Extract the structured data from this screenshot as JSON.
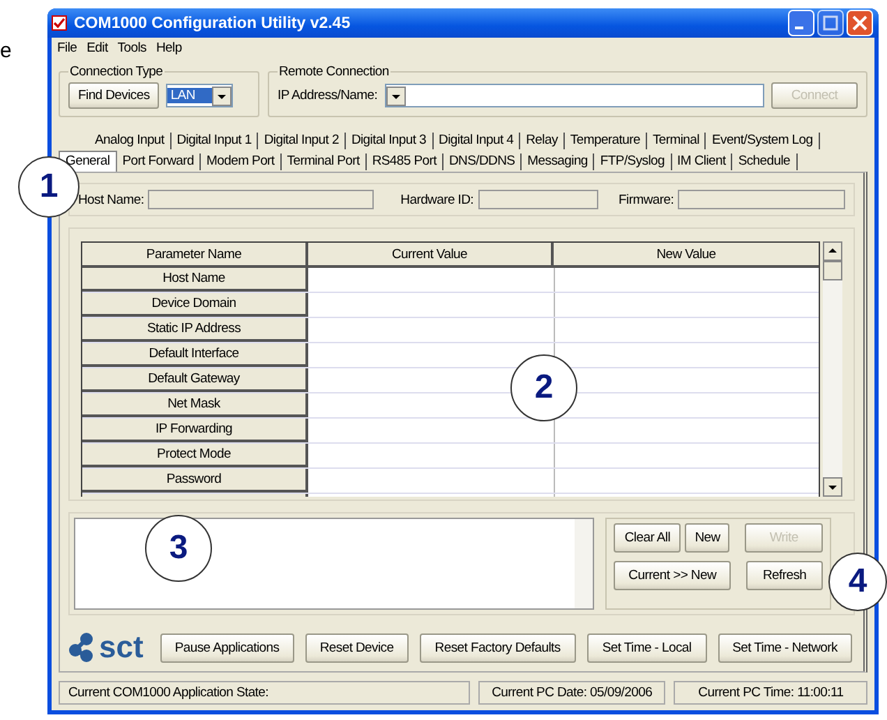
{
  "side_text": "e",
  "window": {
    "title": "COM1000 Configuration Utility v2.45"
  },
  "menu": [
    "File",
    "Edit",
    "Tools",
    "Help"
  ],
  "connection_type": {
    "label": "Connection Type",
    "find_button": "Find Devices",
    "type_value": "LAN"
  },
  "remote_connection": {
    "label": "Remote Connection",
    "address_label": "IP Address/Name:",
    "connect_button": {
      "label": "Connect",
      "disabled": true
    }
  },
  "tabs_row_1": [
    {
      "label": "Analog Input",
      "selected": false
    },
    {
      "label": "Digital Input 1",
      "selected": false
    },
    {
      "label": "Digital Input 2",
      "selected": false
    },
    {
      "label": "Digital Input 3",
      "selected": false
    },
    {
      "label": "Digital Input 4",
      "selected": false
    },
    {
      "label": "Relay",
      "selected": false
    },
    {
      "label": "Temperature",
      "selected": false
    },
    {
      "label": "Terminal",
      "selected": false
    },
    {
      "label": "Event/System Log",
      "selected": false
    }
  ],
  "tabs_row_2": [
    {
      "label": "General",
      "selected": true
    },
    {
      "label": "Port Forward",
      "selected": false
    },
    {
      "label": "Modem Port",
      "selected": false
    },
    {
      "label": "Terminal Port",
      "selected": false
    },
    {
      "label": "RS485 Port",
      "selected": false
    },
    {
      "label": "DNS/DDNS",
      "selected": false
    },
    {
      "label": "Messaging",
      "selected": false
    },
    {
      "label": "FTP/Syslog",
      "selected": false
    },
    {
      "label": "IM Client",
      "selected": false
    },
    {
      "label": "Schedule",
      "selected": false
    }
  ],
  "device_info": [
    {
      "label": "Host Name:"
    },
    {
      "label": "Hardware ID:"
    },
    {
      "label": "Firmware:"
    }
  ],
  "table": {
    "columns": [
      "Parameter Name",
      "Current Value",
      "New Value"
    ],
    "rows": [
      "Host Name",
      "Device Domain",
      "Static IP Address",
      "Default Interface",
      "Default Gateway",
      "Net Mask",
      "IP Forwarding",
      "Protect Mode",
      "Password"
    ]
  },
  "grid_buttons": [
    {
      "label": "Clear All",
      "disabled": false
    },
    {
      "label": "New",
      "disabled": false
    },
    {
      "label": "Write",
      "disabled": true
    },
    {
      "label": "Current >> New",
      "disabled": false
    },
    {
      "label": "Refresh",
      "disabled": false
    }
  ],
  "logo": "sct",
  "action_buttons": [
    "Pause Applications",
    "Reset Device",
    "Reset  Factory Defaults",
    "Set Time - Local",
    "Set Time - Network"
  ],
  "status_bar": [
    "Current COM1000 Application State:",
    "Current PC Date: 05/09/2006",
    "Current PC Time: 11:00:11"
  ],
  "callouts": [
    "1",
    "2",
    "3",
    "4"
  ]
}
